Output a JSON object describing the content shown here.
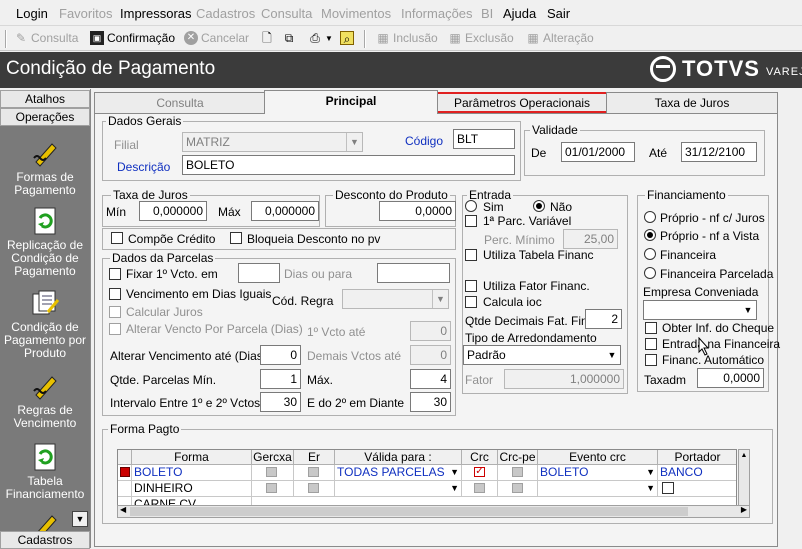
{
  "menubar": {
    "items": [
      {
        "label": "Login",
        "enabled": true
      },
      {
        "label": "Favoritos",
        "enabled": false
      },
      {
        "label": "Impressoras",
        "enabled": true
      },
      {
        "label": "Cadastros",
        "enabled": false
      },
      {
        "label": "Consulta",
        "enabled": false
      },
      {
        "label": "Movimentos",
        "enabled": false
      },
      {
        "label": "Informações",
        "enabled": false
      },
      {
        "label": "BI",
        "enabled": false
      },
      {
        "label": "Ajuda",
        "enabled": true
      },
      {
        "label": "Sair",
        "enabled": true
      }
    ]
  },
  "toolbar": {
    "consulta": "Consulta",
    "confirmacao": "Confirmação",
    "cancelar": "Cancelar",
    "inclusao": "Inclusão",
    "exclusao": "Exclusão",
    "alteracao": "Alteração"
  },
  "window": {
    "title": "Condição de Pagamento",
    "brand": "TOTVS",
    "brand_sub": "VAREJO"
  },
  "sidebar": {
    "atalhos": "Atalhos",
    "operacoes": "Operações",
    "cadastros": "Cadastros",
    "items": [
      {
        "label": "Formas de Pagamento",
        "icon": "pen-icon"
      },
      {
        "label": "Replicação de Condição de Pagamento",
        "icon": "recycle-icon"
      },
      {
        "label": "Condição de Pagamento por Produto",
        "icon": "documents-icon"
      },
      {
        "label": "Regras de Vencimento",
        "icon": "pen-icon"
      },
      {
        "label": "Tabela Financiamento",
        "icon": "recycle-icon"
      }
    ]
  },
  "tabs": [
    {
      "label": "Consulta"
    },
    {
      "label": "Principal"
    },
    {
      "label": "Parâmetros Operacionais"
    },
    {
      "label": "Taxa de Juros"
    }
  ],
  "dados_gerais": {
    "legend": "Dados Gerais",
    "filial_label": "Filial",
    "filial_value": "MATRIZ",
    "codigo_label": "Código",
    "codigo_value": "BLT",
    "descricao_label": "Descrição",
    "descricao_value": "BOLETO"
  },
  "validade": {
    "legend": "Validade",
    "de_label": "De",
    "de_value": "01/01/2000",
    "ate_label": "Até",
    "ate_value": "31/12/2100"
  },
  "taxa_juros": {
    "legend": "Taxa de Juros",
    "min_label": "Mín",
    "min_value": "0,000000",
    "max_label": "Máx",
    "max_value": "0,000000"
  },
  "desconto": {
    "legend": "Desconto do Produto",
    "value": "0,0000"
  },
  "compoe_credito": "Compõe Crédito",
  "bloqueia_desconto": "Bloqueia Desconto no pv",
  "parcelas": {
    "legend": "Dados da Parcelas",
    "fixar": "Fixar 1º Vcto. em",
    "dias_ou_para": "Dias ou para",
    "venc_dias_iguais": "Vencimento em Dias Iguais",
    "cod_regra": "Cód. Regra",
    "calcular_juros": "Calcular Juros",
    "alterar_vencto": "Alterar Vencto Por Parcela (Dias)",
    "primeiro_vcto_ate": "1º Vcto até",
    "primeiro_vcto_value": "0",
    "alterar_venc_ate": "Alterar Vencimento até (Dias)",
    "alterar_venc_value": "0",
    "demais_vctos": "Demais Vctos até",
    "demais_vctos_value": "0",
    "qtde_min_label": "Qtde. Parcelas Mín.",
    "qtde_min_value": "1",
    "max_label": "Máx.",
    "max_value": "4",
    "intervalo_label": "Intervalo Entre 1º e 2º Vctos.",
    "intervalo_value": "30",
    "e_do_2_label": "E do 2º em Diante",
    "e_do_2_value": "30"
  },
  "entrada": {
    "legend": "Entrada",
    "sim": "Sim",
    "nao": "Não",
    "primeira_parc": "1ª Parc. Variável",
    "perc_minimo": "Perc. Mínimo",
    "perc_minimo_value": "25,00",
    "utiliza_tabela": "Utiliza Tabela Financ",
    "utiliza_fator": "Utiliza Fator Financ.",
    "calcula_ioc": "Calcula ioc",
    "qtde_decimais": "Qtde Decimais Fat. Finan",
    "qtde_decimais_value": "2",
    "tipo_arred": "Tipo de Arredondamento",
    "tipo_arred_value": "Padrão",
    "fator": "Fator",
    "fator_value": "1,000000"
  },
  "financiamento": {
    "legend": "Financiamento",
    "options": [
      "Próprio - nf c/ Juros",
      "Próprio - nf a Vista",
      "Financeira",
      "Financeira Parcelada"
    ],
    "selected_index": 1,
    "empresa": "Empresa Conveniada",
    "obter_inf": "Obter Inf. do Cheque",
    "entrada_financeira": "Entrada na Financeira",
    "financ_automatico": "Financ. Automático",
    "taxadm": "Taxadm",
    "taxadm_value": "0,0000"
  },
  "forma_pagto": {
    "legend": "Forma Pagto",
    "headers": [
      "Forma",
      "Gercxa",
      "Er",
      "Válida para :",
      "Crc",
      "Crc-pe",
      "Evento crc",
      "Portador"
    ],
    "rows": [
      {
        "forma": "BOLETO",
        "valida": "TODAS PARCELAS",
        "evento": "BOLETO",
        "portador": "BANCO",
        "crc": true
      },
      {
        "forma": "DINHEIRO",
        "valida": "",
        "evento": "",
        "portador": "",
        "crc": false
      },
      {
        "forma": "CARNE CV",
        "valida": "",
        "evento": "",
        "portador": "",
        "crc": false
      }
    ]
  }
}
